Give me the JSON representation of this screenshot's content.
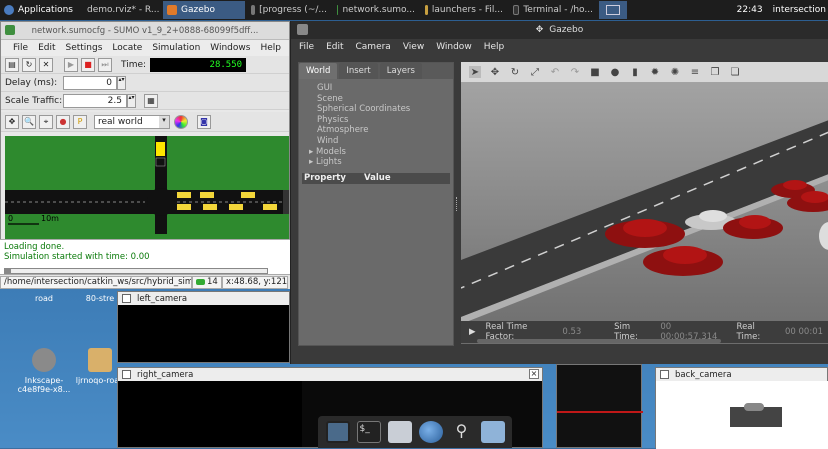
{
  "top_panel": {
    "applications": "Applications",
    "tasks": [
      {
        "label": "demo.rviz* - R...",
        "active": false,
        "color": "#7a4b9c"
      },
      {
        "label": "Gazebo",
        "active": true,
        "color": "#e07a2a"
      },
      {
        "label": "[progress (~/...",
        "active": false,
        "color": "#5a5a5a"
      },
      {
        "label": "network.sumo...",
        "active": false,
        "color": "#3f8f3f"
      },
      {
        "label": "launchers - Fil...",
        "active": false,
        "color": "#c8a040"
      },
      {
        "label": "Terminal - /ho...",
        "active": false,
        "color": "#333333"
      }
    ],
    "clock": "22:43",
    "user": "intersection"
  },
  "sumo": {
    "title": "network.sumocfg - SUMO v1_9_2+0888-68099f5dff...",
    "menu": [
      "File",
      "Edit",
      "Settings",
      "Locate",
      "Simulation",
      "Windows",
      "Help"
    ],
    "time_label": "Time:",
    "time_value": "28.550",
    "delay_label": "Delay (ms):",
    "delay_value": "0",
    "scale_label": "Scale Traffic:",
    "scale_value": "2.5",
    "viewport": "real world",
    "scale_bar_zero": "0",
    "scale_bar_label": "10m",
    "log": [
      "Loading done.",
      "Simulation started with time: 0.00"
    ],
    "status_path": "/home/intersection/catkin_ws/src/hybrid_simula",
    "status_count": "14",
    "status_coords": "x:48.68, y:121."
  },
  "gazebo": {
    "title": "Gazebo",
    "menu": [
      "File",
      "Edit",
      "Camera",
      "View",
      "Window",
      "Help"
    ],
    "tabs": [
      "World",
      "Insert",
      "Layers"
    ],
    "tree": [
      "GUI",
      "Scene",
      "Spherical Coordinates",
      "Physics",
      "Atmosphere",
      "Wind"
    ],
    "tree_expandable": [
      "Models",
      "Lights"
    ],
    "prop_header": "Property",
    "value_header": "Value",
    "rtf_label": "Real Time Factor:",
    "rtf_value": "0.53",
    "sim_time_label": "Sim Time:",
    "sim_time_value": "00 00:00:57.314",
    "real_time_label": "Real Time:",
    "real_time_value": "00 00:01"
  },
  "cameras": {
    "left": "left_camera",
    "right": "right_camera",
    "back": "back_camera"
  },
  "desktop_icons": [
    {
      "label": "road"
    },
    {
      "label": "80-stre"
    },
    {
      "label": "Inkscape-c4e8f9e-x8..."
    },
    {
      "label": "ljrnoqo-road"
    }
  ],
  "colors": {
    "accent": "#3b5b83",
    "sumo_green": "#2e8a2e",
    "car_red": "#b21414"
  }
}
